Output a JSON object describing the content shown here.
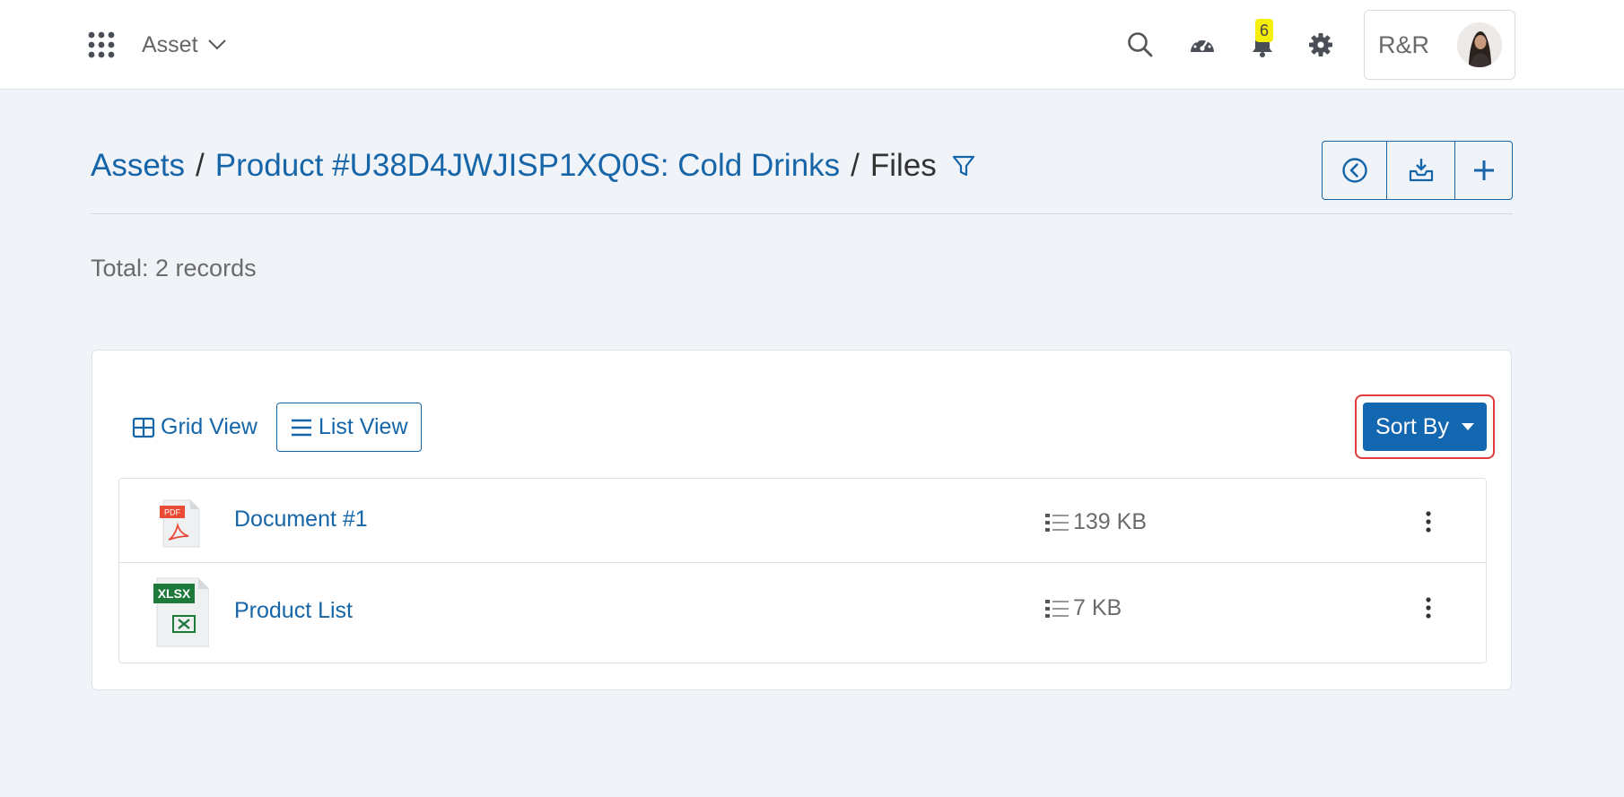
{
  "header": {
    "module_label": "Asset",
    "notifications_count": "6",
    "profile_name": "R&R",
    "icons": [
      "apps-grid-icon",
      "search-icon",
      "dashboard-gauge-icon",
      "bell-icon",
      "gear-icon"
    ]
  },
  "breadcrumb": {
    "items": [
      "Assets",
      "Product #U38D4JWJISP1XQ0S: Cold Drinks"
    ],
    "separator": "/",
    "current": "Files"
  },
  "actions": [
    "back-circle-icon",
    "download-tray-icon",
    "plus-icon"
  ],
  "summary": {
    "total": "Total: 2 records"
  },
  "views": {
    "grid_label": "Grid View",
    "list_label": "List View"
  },
  "sort": {
    "label": "Sort By"
  },
  "files": [
    {
      "name": "Document #1",
      "size": "139 KB",
      "type": "PDF"
    },
    {
      "name": "Product List",
      "size": "7 KB",
      "type": "XLSX"
    }
  ],
  "colors": {
    "accent": "#1565a8",
    "sort_button": "#1366b0",
    "highlight": "#e03a3a",
    "badge": "#f5ee0b"
  }
}
